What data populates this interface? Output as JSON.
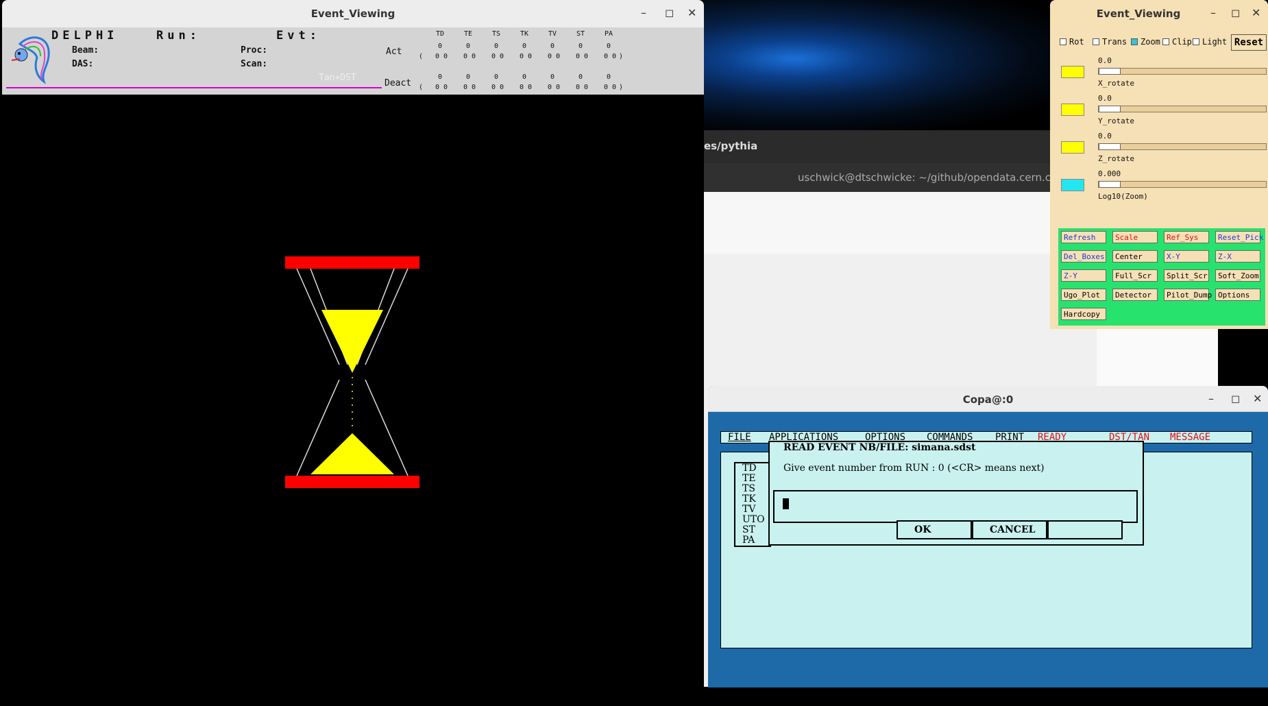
{
  "desktop": {
    "terminal_path": "es/pythia",
    "terminal_host": "uschwick@dtschwicke: ~/github/opendata.cern.ch"
  },
  "win1": {
    "title": "Event_Viewing",
    "header": {
      "delphi": "DELPHI",
      "run": "Run:",
      "evt": "Evt:",
      "beam": "Beam:",
      "das": "DAS:",
      "proc": "Proc:",
      "scan": "Scan:",
      "act": "Act",
      "deact": "Deact",
      "tan_dst": "Tan+DST",
      "cols": [
        "TD",
        "TE",
        "TS",
        "TK",
        "TV",
        "ST",
        "PA"
      ],
      "row_zero": "0",
      "row_pair": "0 0",
      "paren_open": "(",
      "paren_close": ")"
    }
  },
  "win2": {
    "title": "Event_Viewing",
    "checks": [
      {
        "label": "Rot",
        "checked": false
      },
      {
        "label": "Trans",
        "checked": false
      },
      {
        "label": "Zoom",
        "checked": true
      },
      {
        "label": "Clip",
        "checked": false
      },
      {
        "label": "Light",
        "checked": false
      }
    ],
    "reset": "Reset",
    "sliders": [
      {
        "value": "0.0",
        "label": "X_rotate",
        "color": "#ffff00"
      },
      {
        "value": "0.0",
        "label": "Y_rotate",
        "color": "#ffff00"
      },
      {
        "value": "0.0",
        "label": "Z_rotate",
        "color": "#ffff00"
      },
      {
        "value": "0.000",
        "label": "Log10(Zoom)",
        "color": "#22e6f0"
      }
    ],
    "buttons": [
      {
        "label": "Refresh",
        "color": "#1a3ad6"
      },
      {
        "label": "Scale",
        "color": "#e01010"
      },
      {
        "label": "Ref_Sys",
        "color": "#e01010"
      },
      {
        "label": "Reset_Pick",
        "color": "#1a3ad6"
      },
      {
        "label": "Del_Boxes",
        "color": "#1a3ad6"
      },
      {
        "label": "Center",
        "color": "#000000"
      },
      {
        "label": "X-Y",
        "color": "#1a3ad6"
      },
      {
        "label": "Z-X",
        "color": "#1a3ad6"
      },
      {
        "label": "Z-Y",
        "color": "#1a3ad6"
      },
      {
        "label": "Full_Scr",
        "color": "#000000"
      },
      {
        "label": "Split_Scr",
        "color": "#000000"
      },
      {
        "label": "Soft_Zoom",
        "color": "#000000"
      },
      {
        "label": "Ugo_Plot",
        "color": "#000000"
      },
      {
        "label": "Detector",
        "color": "#000000"
      },
      {
        "label": "Pilot_Dump",
        "color": "#000000"
      },
      {
        "label": "Options",
        "color": "#000000"
      },
      {
        "label": "Hardcopy",
        "color": "#000000"
      }
    ]
  },
  "win3": {
    "title": "Copa@:0",
    "menu": [
      "FILE",
      "APPLICATIONS",
      "OPTIONS",
      "COMMANDS",
      "PRINT"
    ],
    "status": [
      "READY",
      "DST/TAN",
      "MESSAGE"
    ],
    "detectors": [
      "TD",
      "TE",
      "TS",
      "TK",
      "TV",
      "UTO",
      "ST",
      "PA"
    ],
    "dialog": {
      "header": "READ EVENT NB/FILE: simana.sdst",
      "message": "Give event number from RUN : 0 (<CR> means next)",
      "ok": "OK",
      "cancel": "CANCEL"
    }
  },
  "colors": {
    "hourglass_frame": "#ff0000",
    "sand": "#ffff00"
  }
}
